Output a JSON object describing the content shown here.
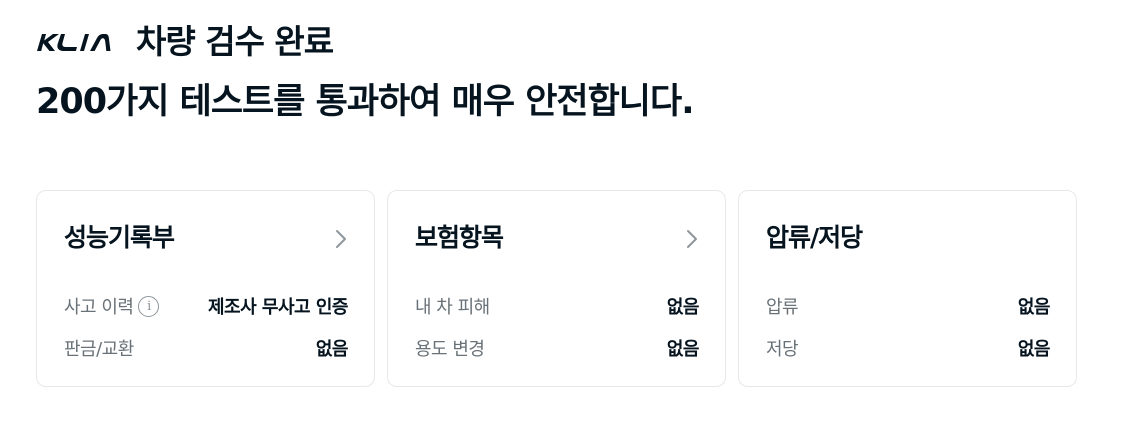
{
  "header": {
    "brand_icon": "kia-logo",
    "title": "차량 검수 완료"
  },
  "subtitle": "200가지 테스트를 통과하여 매우 안전합니다.",
  "cards": [
    {
      "title": "성능기록부",
      "has_chevron": true,
      "rows": [
        {
          "label": "사고 이력",
          "info_icon": "info-icon",
          "value": "제조사 무사고 인증"
        },
        {
          "label": "판금/교환",
          "value": "없음"
        }
      ]
    },
    {
      "title": "보험항목",
      "has_chevron": true,
      "rows": [
        {
          "label": "내 차 피해",
          "value": "없음"
        },
        {
          "label": "용도 변경",
          "value": "없음"
        }
      ]
    },
    {
      "title": "압류/저당",
      "has_chevron": false,
      "rows": [
        {
          "label": "압류",
          "value": "없음"
        },
        {
          "label": "저당",
          "value": "없음"
        }
      ]
    }
  ],
  "colors": {
    "text_primary": "#05141f",
    "text_secondary": "#697278",
    "card_border": "#e6e8ea",
    "icon_gray": "#8e969b"
  }
}
